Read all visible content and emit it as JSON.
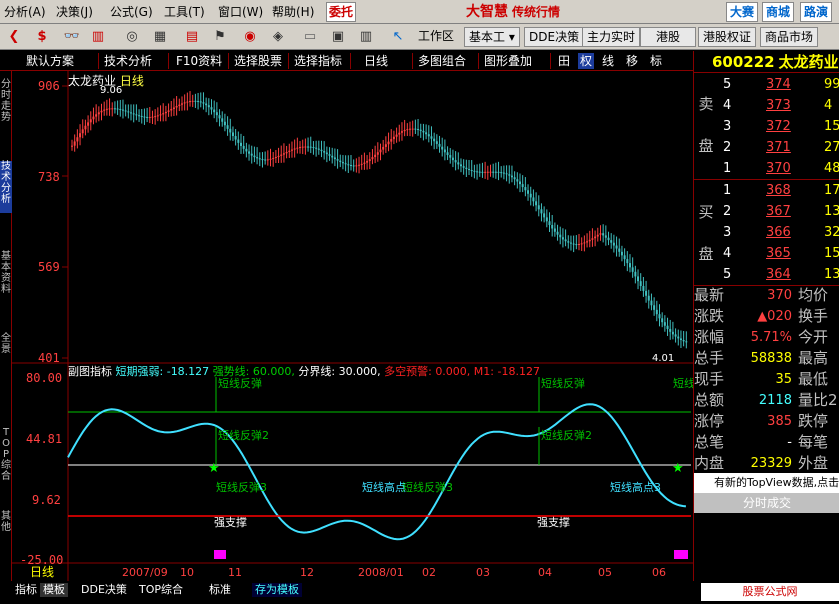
{
  "menu": {
    "items": [
      "分析(A)",
      "决策(J)",
      "公式(G)",
      "工具(T)",
      "窗口(W)",
      "帮助(H)"
    ],
    "entrust": "委托",
    "brand": "大智慧",
    "slogan": "传统行情",
    "right_buttons": [
      "大赛",
      "商城",
      "路演"
    ]
  },
  "toolbar1": {
    "workspace_label": "工作区",
    "basic_label": "基本工",
    "buttons": [
      "DDE决策",
      "主力实时",
      "港股",
      "港股权证",
      "商品市场"
    ]
  },
  "toolbar2": {
    "items": [
      "默认方案",
      "技术分析",
      "F10资料",
      "选择股票",
      "选择指标",
      "日线",
      "多图组合",
      "图形叠加"
    ],
    "icons": [
      "田",
      "权",
      "线",
      "移",
      "标"
    ]
  },
  "left_tabs": [
    {
      "label": "分时走势",
      "active": false
    },
    {
      "label": "技术分析",
      "active": true
    },
    {
      "label": "基本资料",
      "active": false
    },
    {
      "label": "全景",
      "active": false
    },
    {
      "label": "TOP综合",
      "active": false
    },
    {
      "label": "其他",
      "active": false
    }
  ],
  "chart": {
    "title_prefix": "太龙药业",
    "title_period": "日线",
    "high_marker": "9.06",
    "last_marker": "4.01",
    "y_labels": [
      "906",
      "738",
      "569",
      "401"
    ],
    "sub_y_labels": [
      "80.00",
      "44.81",
      "9.62",
      "-25.00"
    ],
    "sub_header": {
      "name": "副图指标",
      "short": "短期强弱:",
      "short_v": "-18.127",
      "strong": "强势线: 60.000,",
      "split": "分界线: 30.000,",
      "warn": "多空预警:",
      "warn_v": "0.000, M1: -18.127"
    },
    "annotations": {
      "rebound": "短线反弹",
      "rebound2": "短线反弹2",
      "rebound3": "短线反弹3",
      "high_point": "短线高点",
      "high_point3": "短线高点3",
      "support": "强支撑",
      "rebound_cut": "短线"
    },
    "x_labels": [
      "2007/09",
      "10",
      "11",
      "12",
      "2008/01",
      "02",
      "03",
      "04",
      "05",
      "06"
    ],
    "period_tag": "日线"
  },
  "quote": {
    "code": "600222",
    "name": "太龙药业",
    "sell_label": [
      "卖",
      "盘"
    ],
    "buy_label": [
      "买",
      "盘"
    ],
    "sell": [
      {
        "lv": "5",
        "price": "374",
        "qty": "99"
      },
      {
        "lv": "4",
        "price": "373",
        "qty": "4"
      },
      {
        "lv": "3",
        "price": "372",
        "qty": "15"
      },
      {
        "lv": "2",
        "price": "371",
        "qty": "27"
      },
      {
        "lv": "1",
        "price": "370",
        "qty": "48"
      }
    ],
    "buy": [
      {
        "lv": "1",
        "price": "368",
        "qty": "17"
      },
      {
        "lv": "2",
        "price": "367",
        "qty": "13"
      },
      {
        "lv": "3",
        "price": "366",
        "qty": "32"
      },
      {
        "lv": "4",
        "price": "365",
        "qty": "15"
      },
      {
        "lv": "5",
        "price": "364",
        "qty": "13"
      }
    ],
    "stats": [
      {
        "k1": "最新",
        "v1": "370",
        "k2": "均价"
      },
      {
        "k1": "涨跌",
        "v1": "▲020",
        "k2": "换手"
      },
      {
        "k1": "涨幅",
        "v1": "5.71%",
        "k2": "今开"
      },
      {
        "k1": "总手",
        "v1": "58838",
        "k2": "最高"
      },
      {
        "k1": "现手",
        "v1": "35",
        "k2": "最低"
      },
      {
        "k1": "总额",
        "v1": "2118",
        "k2": "量比2"
      },
      {
        "k1": "涨停",
        "v1": "385",
        "k2": "跌停"
      },
      {
        "k1": "总笔",
        "v1": "-",
        "k2": "每笔"
      },
      {
        "k1": "内盘",
        "v1": "23329",
        "k2": "外盘"
      }
    ],
    "notice": "有新的TopView数据,点击",
    "time_trade": "分时成交"
  },
  "bottom_tabs": [
    "指标",
    "模板",
    "DDE决策",
    "TOP综合",
    "标准",
    "存为模板"
  ],
  "footer_brand": "股票公式网 www.88gg.com",
  "colors": {
    "up": "#ff4040",
    "down": "#40c0c0",
    "short_line": "#40e0ff",
    "strong_line": "#00c000",
    "split_line": "#ffffff",
    "warn_line": "#ff0000"
  }
}
